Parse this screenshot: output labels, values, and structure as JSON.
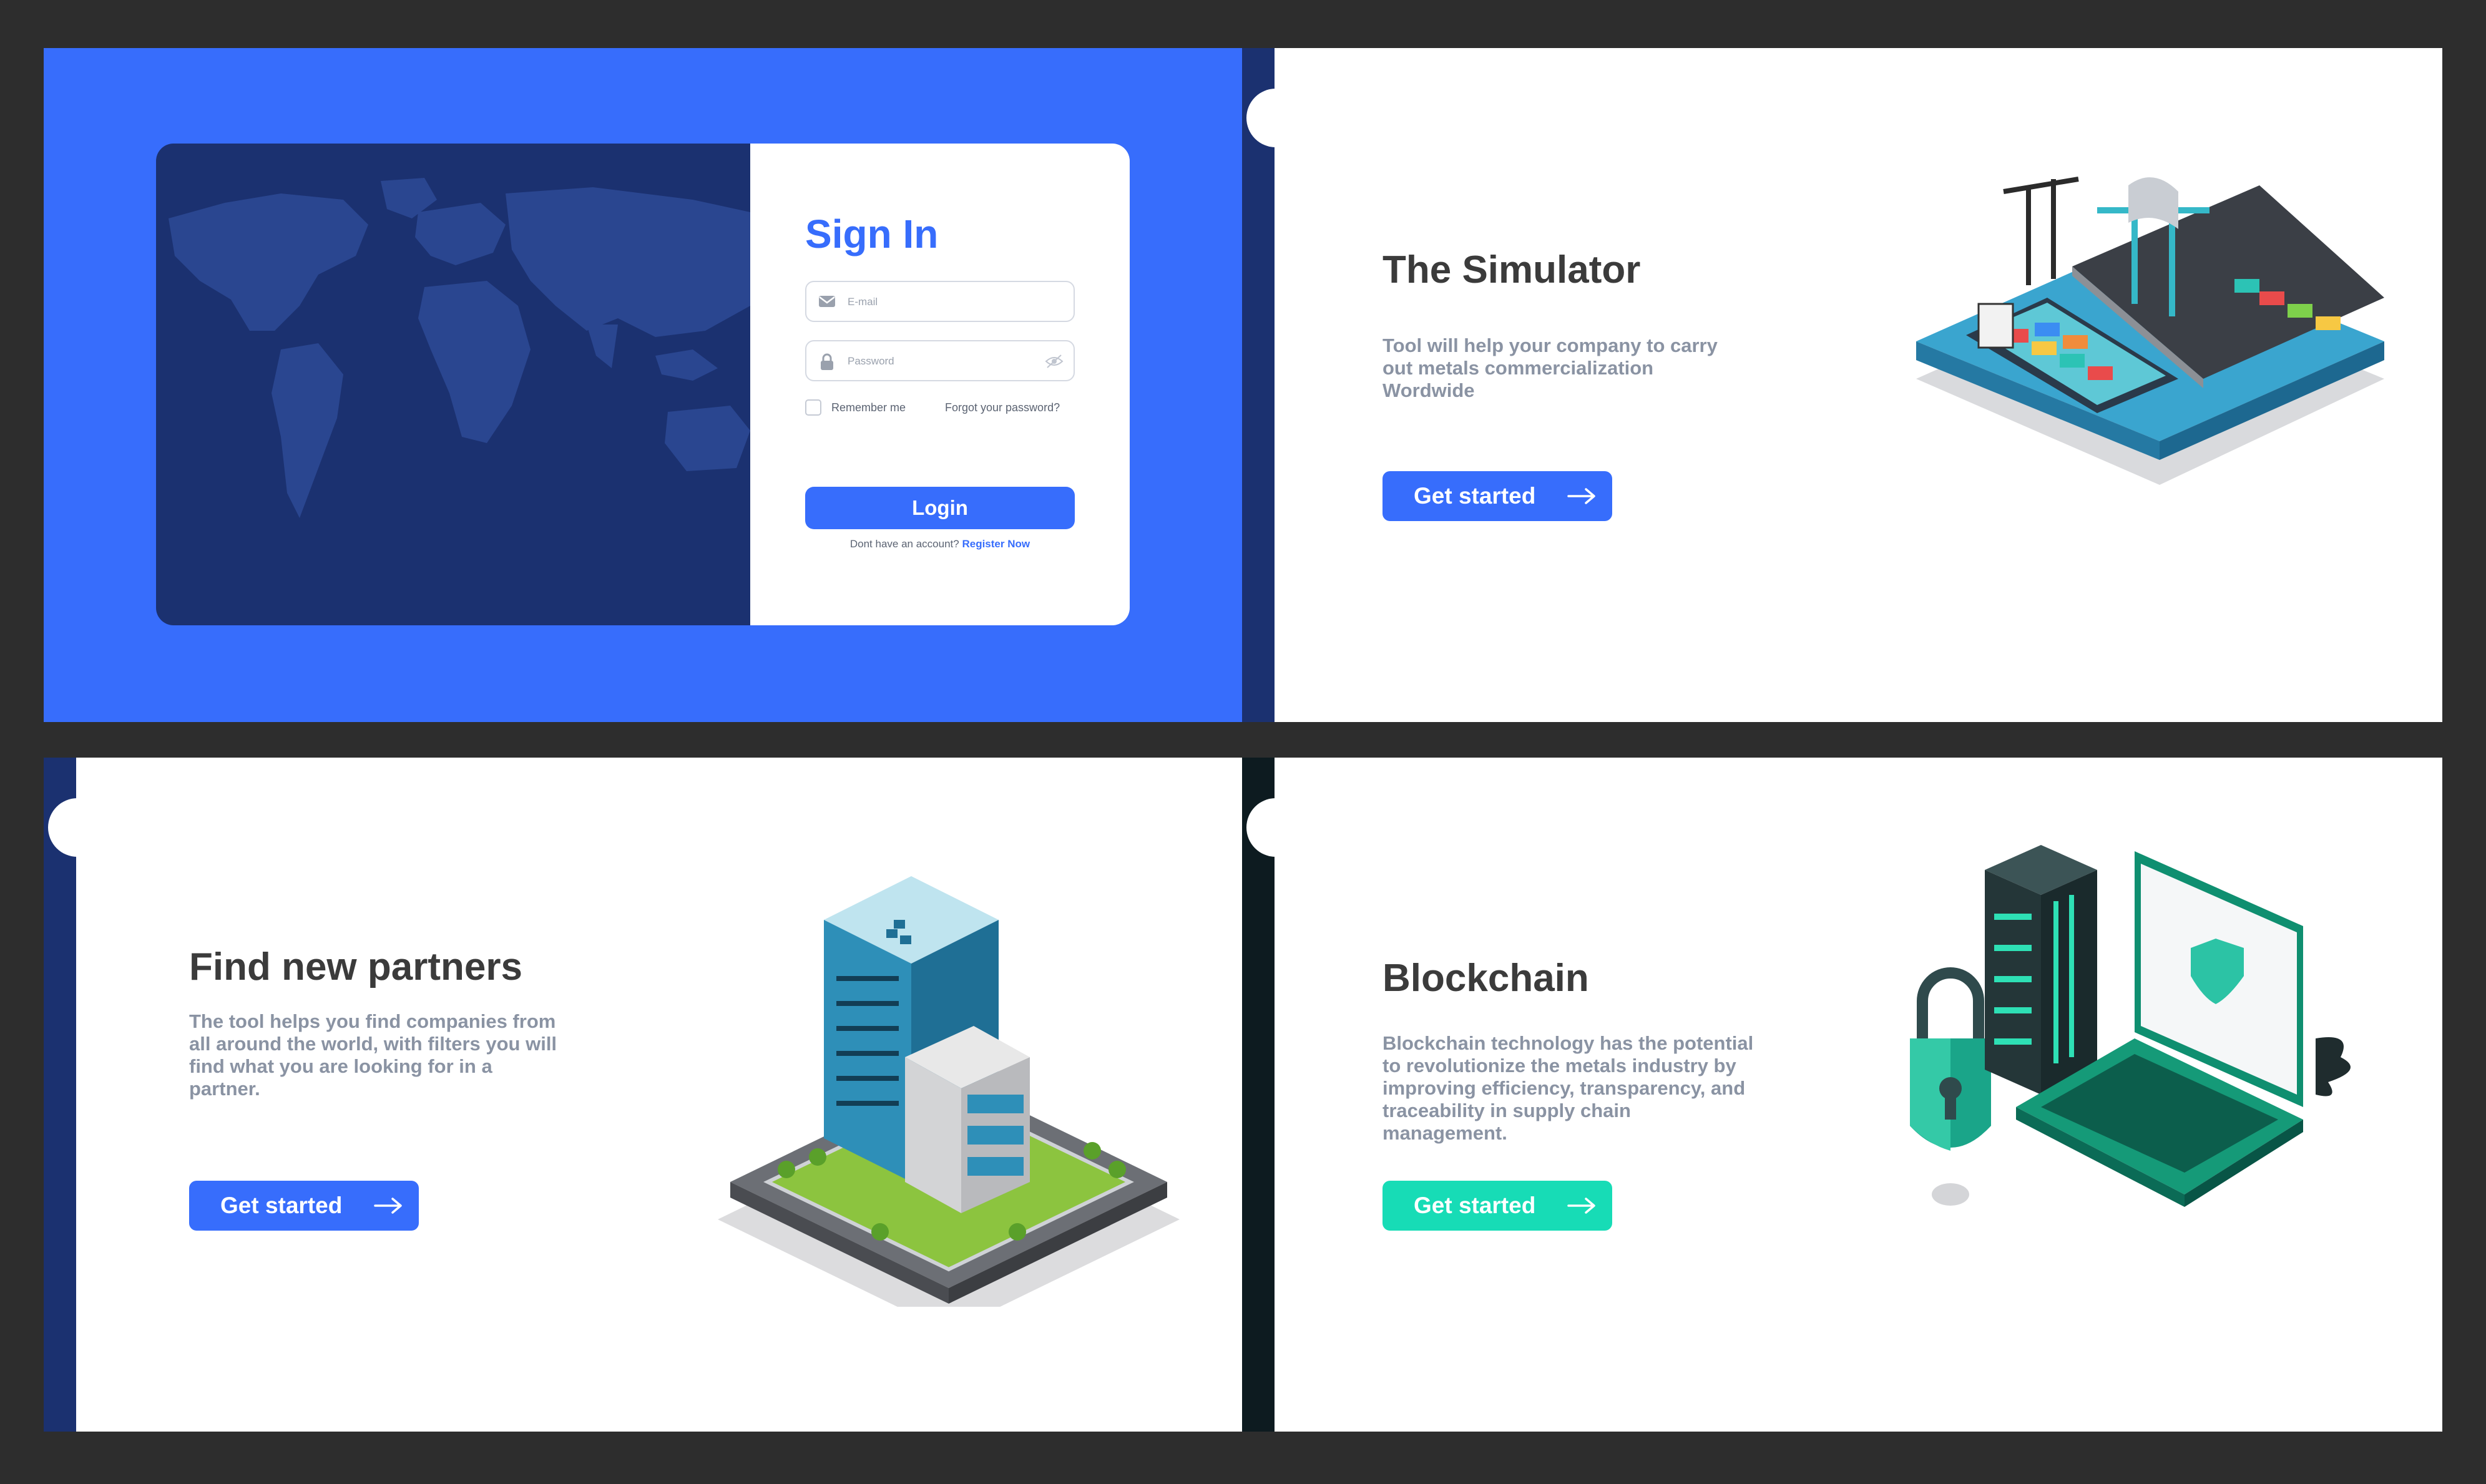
{
  "signin": {
    "title": "Sign In",
    "email_placeholder": "E-mail",
    "password_placeholder": "Password",
    "remember_label": "Remember me",
    "forgot_label": "Forgot your password?",
    "login_label": "Login",
    "signup_prompt": "Dont have an account?",
    "register_label": "Register Now"
  },
  "simulator": {
    "title": "The Simulator",
    "description": "Tool will help your company to carry out metals commercialization Wordwide",
    "cta_label": "Get started"
  },
  "partners": {
    "title": "Find new partners",
    "description": "The tool helps you find companies from all around the world, with filters you will find what you are looking for in a partner.",
    "cta_label": "Get started"
  },
  "blockchain": {
    "title": "Blockchain",
    "description": "Blockchain technology has the potential to revolutionize the metals industry by improving efficiency, transparency, and traceability in supply chain management.",
    "cta_label": "Get started"
  },
  "colors": {
    "brand_blue": "#376dfc",
    "navy": "#1b3170",
    "teal": "#17dcb6",
    "dark_teal": "#0d1b20",
    "title_gray": "#3b3b3b",
    "text_gray": "#8a93a3"
  },
  "icons": [
    "mail-icon",
    "lock-icon",
    "eye-off-icon",
    "arrow-right-icon",
    "world-map",
    "port-illustration",
    "building-illustration",
    "blockchain-illustration"
  ]
}
